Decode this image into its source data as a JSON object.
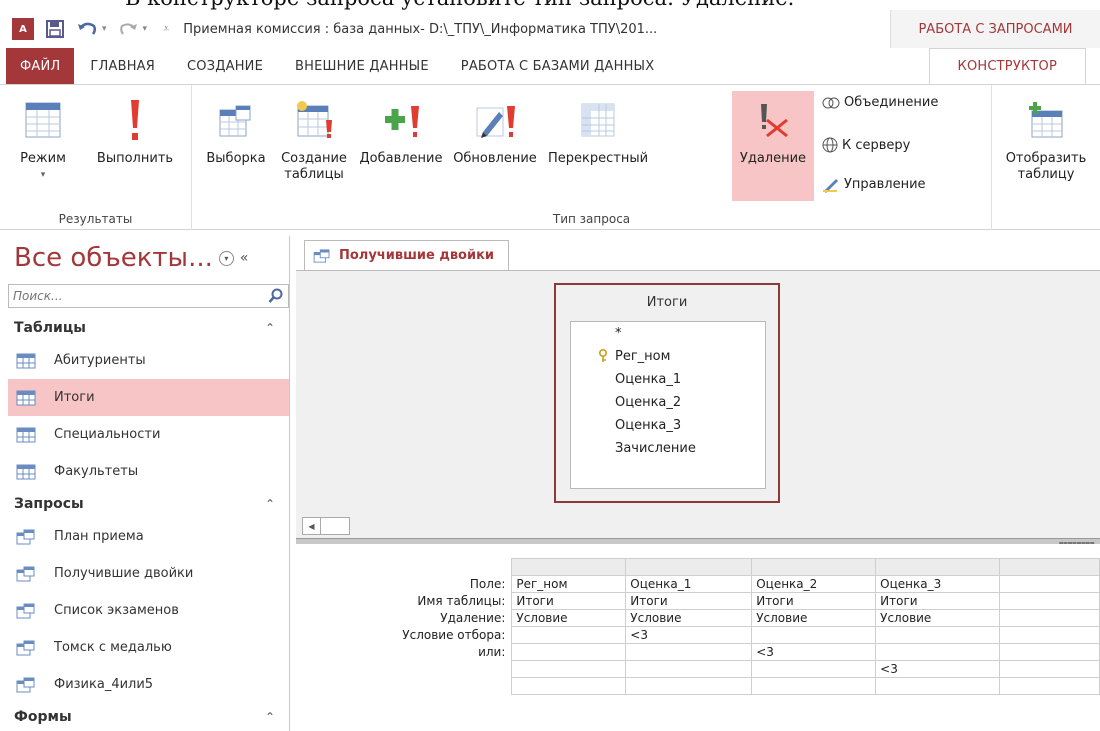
{
  "caption": "В конструкторе запроса установите тип запроса: Удаление.",
  "titlebar": {
    "app_icon": "A",
    "title": "Приемная комиссия : база данных- D:\\_ТПУ\\_Информатика ТПУ\\201...",
    "context_tab": "РАБОТА С ЗАПРОСАМИ"
  },
  "tabs": {
    "file": "ФАЙЛ",
    "home": "ГЛАВНАЯ",
    "create": "СОЗДАНИЕ",
    "external": "ВНЕШНИЕ ДАННЫЕ",
    "database": "РАБОТА С БАЗАМИ ДАННЫХ",
    "design": "КОНСТРУКТОР"
  },
  "ribbon": {
    "results": {
      "label": "Результаты",
      "view": "Режим",
      "run": "Выполнить"
    },
    "query_type": {
      "label": "Тип запроса",
      "select": "Выборка",
      "make_table_1": "Создание",
      "make_table_2": "таблицы",
      "append": "Добавление",
      "update": "Обновление",
      "crosstab": "Перекрестный",
      "delete": "Удаление",
      "union": "Объединение",
      "pass_through": "К серверу",
      "data_definition": "Управление"
    },
    "show_table_1": "Отобразить",
    "show_table_2": "таблицу"
  },
  "nav": {
    "title": "Все объекты...",
    "search_placeholder": "Поиск...",
    "sections": {
      "tables": "Таблицы",
      "queries": "Запросы",
      "forms": "Формы"
    },
    "tables": [
      "Абитуриенты",
      "Итоги",
      "Специальности",
      "Факультеты"
    ],
    "queries": [
      "План приема",
      "Получившие двойки",
      "Список экзаменов",
      "Томск с медалью",
      "Физика_4или5"
    ]
  },
  "doc": {
    "tab": "Получившие двойки",
    "table": {
      "title": "Итоги",
      "fields": [
        "*",
        "Рег_ном",
        "Оценка_1",
        "Оценка_2",
        "Оценка_3",
        "Зачисление"
      ]
    },
    "grid": {
      "row_labels": [
        "Поле:",
        "Имя таблицы:",
        "Удаление:",
        "Условие отбора:",
        "или:"
      ],
      "columns": [
        {
          "field": "Рег_ном",
          "table": "Итоги",
          "delete": "Условие",
          "criteria": "",
          "or": "",
          "or2": ""
        },
        {
          "field": "Оценка_1",
          "table": "Итоги",
          "delete": "Условие",
          "criteria": "<3",
          "or": "",
          "or2": ""
        },
        {
          "field": "Оценка_2",
          "table": "Итоги",
          "delete": "Условие",
          "criteria": "",
          "or": "<3",
          "or2": ""
        },
        {
          "field": "Оценка_3",
          "table": "Итоги",
          "delete": "Условие",
          "criteria": "",
          "or": "",
          "or2": "<3"
        }
      ]
    }
  },
  "colors": {
    "accent": "#a4373a",
    "highlight": "#f7c5c5"
  }
}
